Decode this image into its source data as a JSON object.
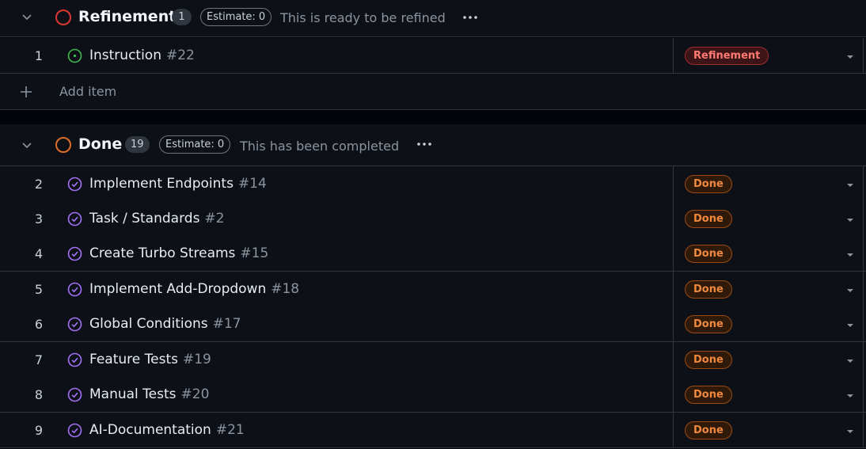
{
  "colors": {
    "refinement_ring": "#da3633",
    "done_ring": "#db6d28",
    "open_icon": "#3fb950",
    "closed_icon": "#a371f7"
  },
  "groups": [
    {
      "title": "Refinement",
      "count": "1",
      "estimate": "Estimate: 0",
      "description": "This is ready to be refined",
      "items": [
        {
          "index": "1",
          "title": "Instruction",
          "number": "#22",
          "status": "Refinement",
          "icon": "open-issue-icon"
        }
      ],
      "add_item_label": "Add item"
    },
    {
      "title": "Done",
      "count": "19",
      "estimate": "Estimate: 0",
      "description": "This has been completed",
      "items": [
        {
          "index": "2",
          "title": "Implement Endpoints",
          "number": "#14",
          "status": "Done",
          "icon": "closed-issue-icon"
        },
        {
          "index": "3",
          "title": "Task / Standards",
          "number": "#2",
          "status": "Done",
          "icon": "closed-issue-icon"
        },
        {
          "index": "4",
          "title": "Create Turbo Streams",
          "number": "#15",
          "status": "Done",
          "icon": "closed-issue-icon"
        },
        {
          "index": "5",
          "title": "Implement Add-Dropdown",
          "number": "#18",
          "status": "Done",
          "icon": "closed-issue-icon"
        },
        {
          "index": "6",
          "title": "Global Conditions",
          "number": "#17",
          "status": "Done",
          "icon": "closed-issue-icon"
        },
        {
          "index": "7",
          "title": "Feature Tests",
          "number": "#19",
          "status": "Done",
          "icon": "closed-issue-icon"
        },
        {
          "index": "8",
          "title": "Manual Tests",
          "number": "#20",
          "status": "Done",
          "icon": "closed-issue-icon"
        },
        {
          "index": "9",
          "title": "AI-Documentation",
          "number": "#21",
          "status": "Done",
          "icon": "closed-issue-icon"
        }
      ]
    }
  ]
}
